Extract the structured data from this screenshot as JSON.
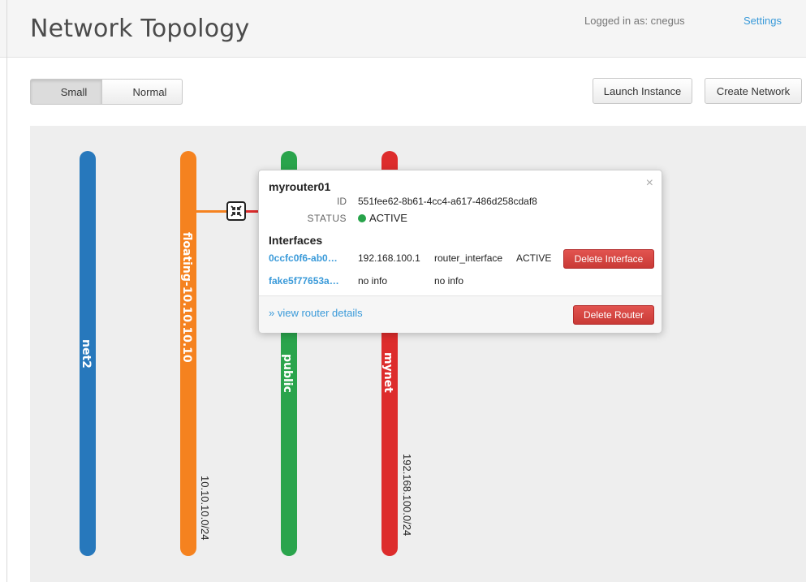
{
  "header": {
    "title": "Network Topology",
    "logged_in": "Logged in as: cnegus",
    "settings": "Settings"
  },
  "toolbar": {
    "small_label": "Small",
    "normal_label": "Normal",
    "launch_label": "Launch Instance",
    "create_label": "Create Network"
  },
  "networks": [
    {
      "name": "net2",
      "color": "#2778bc",
      "cidr": ""
    },
    {
      "name": "floating-10.10.10.10",
      "color": "#f5821f",
      "cidr": "10.10.10.0/24"
    },
    {
      "name": "public",
      "color": "#2aa44c",
      "cidr": ""
    },
    {
      "name": "mynet",
      "color": "#dd2c2c",
      "cidr": "192.168.100.0/24"
    }
  ],
  "popup": {
    "name": "myrouter01",
    "id_label": "ID",
    "id_value": "551fee62-8b61-4cc4-a617-486d258cdaf8",
    "status_label": "STATUS",
    "status_value": "ACTIVE",
    "interfaces_heading": "Interfaces",
    "interfaces": [
      {
        "id": "0ccfc0f6-ab0…",
        "ip": "192.168.100.1",
        "type": "router_interface",
        "status": "ACTIVE",
        "action": "Delete Interface"
      },
      {
        "id": "fake5f77653a…",
        "ip": "no info",
        "type": "no info",
        "status": "",
        "action": ""
      }
    ],
    "view_details": "» view router details",
    "delete_router": "Delete Router",
    "close": "×"
  }
}
